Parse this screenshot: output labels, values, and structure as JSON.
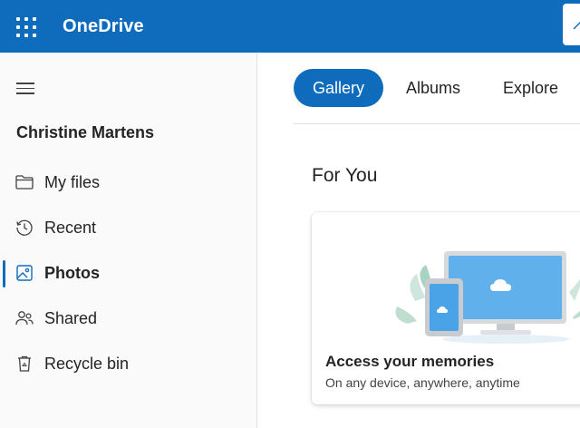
{
  "app": {
    "title": "OneDrive"
  },
  "sidebar": {
    "user_name": "Christine Martens",
    "items": [
      {
        "label": "My files",
        "icon": "folder-icon"
      },
      {
        "label": "Recent",
        "icon": "clock-icon"
      },
      {
        "label": "Photos",
        "icon": "image-icon",
        "active": true
      },
      {
        "label": "Shared",
        "icon": "people-icon"
      },
      {
        "label": "Recycle bin",
        "icon": "recycle-bin-icon"
      }
    ]
  },
  "main": {
    "tabs": [
      {
        "label": "Gallery",
        "active": true
      },
      {
        "label": "Albums"
      },
      {
        "label": "Explore"
      }
    ],
    "section_title": "For You",
    "card": {
      "title": "Access your memories",
      "subtitle": "On any device, anywhere, anytime"
    }
  },
  "colors": {
    "brand": "#0f6cbd",
    "sidebar_bg": "#fafafa"
  }
}
